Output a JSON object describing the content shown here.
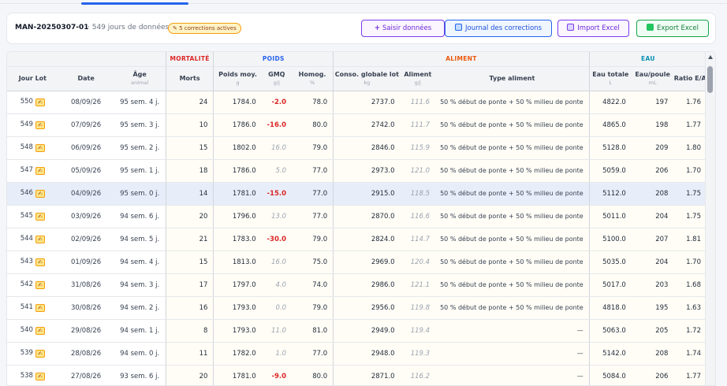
{
  "header": {
    "lot_id": "MAN-20250307-01",
    "days_text": "· 549 jours de données ·",
    "corrections_badge": "5 corrections actives"
  },
  "buttons": {
    "saisir": "Saisir données",
    "journal": "Journal des corrections",
    "import": "Import Excel",
    "export": "Export Excel"
  },
  "groups": {
    "mortalite": "MORTALITÉ",
    "poids": "POIDS",
    "aliment": "ALIMENT",
    "eau": "EAU"
  },
  "columns": {
    "jour": "Jour Lot",
    "date": "Date",
    "age": "Âge",
    "age_unit": "animal",
    "morts": "Morts",
    "poids_moy": "Poids moy.",
    "poids_unit": "g",
    "gmq": "GMQ",
    "gmq_unit": "g/j",
    "homog": "Homog.",
    "homog_unit": "%",
    "conso": "Conso. globale lot",
    "conso_unit": "kg",
    "aliment": "Aliment",
    "aliment_unit": "g/j",
    "type": "Type aliment",
    "eau_totale": "Eau totale",
    "eau_unit": "L",
    "eau_poule": "Eau/poule",
    "eau_poule_unit": "mL",
    "ratio": "Ratio E/A"
  },
  "rows": [
    {
      "jour": "550",
      "date": "08/09/26",
      "age": "95 sem. 4 j.",
      "morts": "24",
      "poids": "1784.0",
      "gmq": "-2.0",
      "homog": "78.0",
      "conso": "2737.0",
      "aliment": "111.6",
      "type": "50 % début de ponte + 50 % milieu de ponte",
      "eau": "4822.0",
      "eau_poule": "197",
      "ratio": "1.76"
    },
    {
      "jour": "549",
      "date": "07/09/26",
      "age": "95 sem. 3 j.",
      "morts": "10",
      "poids": "1786.0",
      "gmq": "-16.0",
      "homog": "80.0",
      "conso": "2742.0",
      "aliment": "111.7",
      "type": "50 % début de ponte + 50 % milieu de ponte",
      "eau": "4865.0",
      "eau_poule": "198",
      "ratio": "1.77"
    },
    {
      "jour": "548",
      "date": "06/09/26",
      "age": "95 sem. 2 j.",
      "morts": "15",
      "poids": "1802.0",
      "gmq": "16.0",
      "homog": "79.0",
      "conso": "2846.0",
      "aliment": "115.9",
      "type": "50 % début de ponte + 50 % milieu de ponte",
      "eau": "5128.0",
      "eau_poule": "209",
      "ratio": "1.80"
    },
    {
      "jour": "547",
      "date": "05/09/26",
      "age": "95 sem. 1 j.",
      "morts": "18",
      "poids": "1786.0",
      "gmq": "5.0",
      "homog": "77.0",
      "conso": "2973.0",
      "aliment": "121.0",
      "type": "50 % début de ponte + 50 % milieu de ponte",
      "eau": "5059.0",
      "eau_poule": "206",
      "ratio": "1.70"
    },
    {
      "jour": "546",
      "date": "04/09/26",
      "age": "95 sem. 0 j.",
      "morts": "14",
      "poids": "1781.0",
      "gmq": "-15.0",
      "homog": "77.0",
      "conso": "2915.0",
      "aliment": "118.5",
      "type": "50 % début de ponte + 50 % milieu de ponte",
      "eau": "5112.0",
      "eau_poule": "208",
      "ratio": "1.75"
    },
    {
      "jour": "545",
      "date": "03/09/26",
      "age": "94 sem. 6 j.",
      "morts": "20",
      "poids": "1796.0",
      "gmq": "13.0",
      "homog": "77.0",
      "conso": "2870.0",
      "aliment": "116.6",
      "type": "50 % début de ponte + 50 % milieu de ponte",
      "eau": "5011.0",
      "eau_poule": "204",
      "ratio": "1.75"
    },
    {
      "jour": "544",
      "date": "02/09/26",
      "age": "94 sem. 5 j.",
      "morts": "21",
      "poids": "1783.0",
      "gmq": "-30.0",
      "homog": "79.0",
      "conso": "2824.0",
      "aliment": "114.7",
      "type": "50 % début de ponte + 50 % milieu de ponte",
      "eau": "5100.0",
      "eau_poule": "207",
      "ratio": "1.81"
    },
    {
      "jour": "543",
      "date": "01/09/26",
      "age": "94 sem. 4 j.",
      "morts": "15",
      "poids": "1813.0",
      "gmq": "16.0",
      "homog": "75.0",
      "conso": "2969.0",
      "aliment": "120.4",
      "type": "50 % début de ponte + 50 % milieu de ponte",
      "eau": "5035.0",
      "eau_poule": "204",
      "ratio": "1.70"
    },
    {
      "jour": "542",
      "date": "31/08/26",
      "age": "94 sem. 3 j.",
      "morts": "17",
      "poids": "1797.0",
      "gmq": "4.0",
      "homog": "74.0",
      "conso": "2986.0",
      "aliment": "121.1",
      "type": "50 % début de ponte + 50 % milieu de ponte",
      "eau": "5017.0",
      "eau_poule": "203",
      "ratio": "1.68"
    },
    {
      "jour": "541",
      "date": "30/08/26",
      "age": "94 sem. 2 j.",
      "morts": "16",
      "poids": "1793.0",
      "gmq": "0.0",
      "homog": "79.0",
      "conso": "2956.0",
      "aliment": "119.8",
      "type": "50 % début de ponte + 50 % milieu de ponte",
      "eau": "4818.0",
      "eau_poule": "195",
      "ratio": "1.63"
    },
    {
      "jour": "540",
      "date": "29/08/26",
      "age": "94 sem. 1 j.",
      "morts": "8",
      "poids": "1793.0",
      "gmq": "11.0",
      "homog": "81.0",
      "conso": "2949.0",
      "aliment": "119.4",
      "type": "—",
      "eau": "5063.0",
      "eau_poule": "205",
      "ratio": "1.72"
    },
    {
      "jour": "539",
      "date": "28/08/26",
      "age": "94 sem. 0 j.",
      "morts": "11",
      "poids": "1782.0",
      "gmq": "1.0",
      "homog": "77.0",
      "conso": "2948.0",
      "aliment": "119.3",
      "type": "—",
      "eau": "5142.0",
      "eau_poule": "208",
      "ratio": "1.74"
    },
    {
      "jour": "538",
      "date": "27/08/26",
      "age": "93 sem. 6 j.",
      "morts": "20",
      "poids": "1781.0",
      "gmq": "-9.0",
      "homog": "80.0",
      "conso": "2871.0",
      "aliment": "116.2",
      "type": "—",
      "eau": "5084.0",
      "eau_poule": "206",
      "ratio": "1.77"
    }
  ],
  "selected_row": "546",
  "icons": {
    "correction": "pencil-icon",
    "add": "plus-icon",
    "journal": "clipboard-icon",
    "import": "upload-icon",
    "export": "spreadsheet-icon"
  },
  "colors": {
    "accent": "#2563eb",
    "negative": "#dc2626",
    "mortalite": "#dc2626",
    "poids": "#2563eb",
    "aliment": "#ea580c",
    "eau": "#0891b2"
  }
}
